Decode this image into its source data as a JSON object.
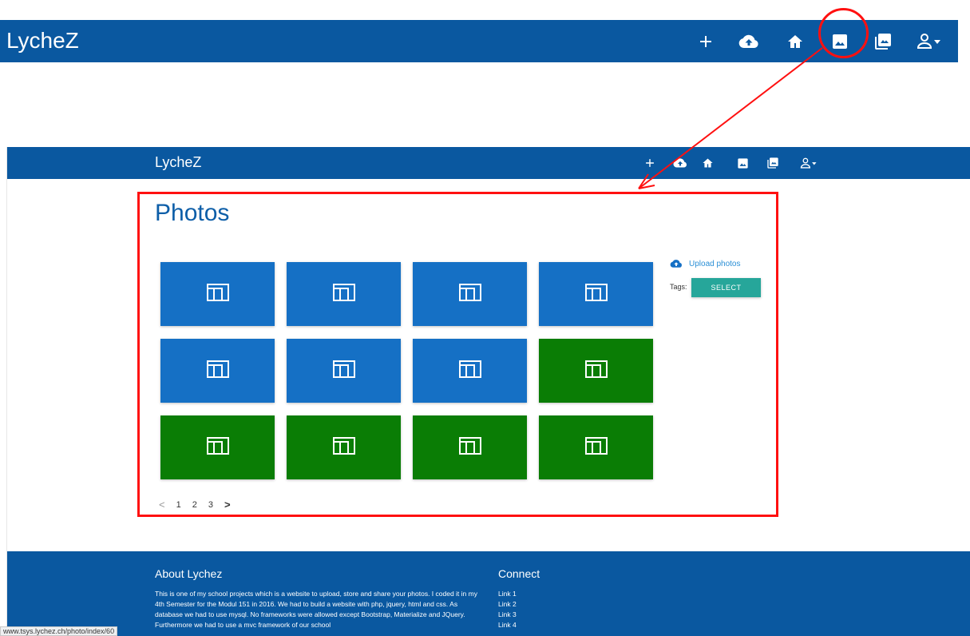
{
  "top_nav": {
    "brand": "LycheZ",
    "icons": [
      "plus-icon",
      "cloud-upload-icon",
      "home-icon",
      "image-icon",
      "photo-library-icon",
      "account-dropdown-icon"
    ]
  },
  "inner_nav": {
    "brand": "LycheZ"
  },
  "main": {
    "title": "Photos",
    "thumbnails": [
      {
        "color": "#1570c5"
      },
      {
        "color": "#1570c5"
      },
      {
        "color": "#1570c5"
      },
      {
        "color": "#1570c5"
      },
      {
        "color": "#1570c5"
      },
      {
        "color": "#1570c5"
      },
      {
        "color": "#1570c5"
      },
      {
        "color": "#0a7d05"
      },
      {
        "color": "#0a7d05"
      },
      {
        "color": "#0a7d05"
      },
      {
        "color": "#0a7d05"
      },
      {
        "color": "#0a7d05"
      }
    ],
    "sidebar": {
      "upload_label": "Upload photos",
      "tags_label": "Tags:",
      "select_label": "SELECT"
    },
    "pagination": {
      "prev": "<",
      "pages": [
        "1",
        "2",
        "3"
      ],
      "next": ">"
    }
  },
  "footer": {
    "about_title": "About Lychez",
    "about_text": "This is one of my school projects which is a website to upload, store and share your photos. I coded it in my 4th Semester for the Modul 151 in 2016. We had to build a website with php, jquery, html and css. As database we had to use mysql. No frameworks were allowed except Bootstrap, Materialize and JQuery. Furthermore we had to use a mvc framework of our school",
    "connect_title": "Connect",
    "links": [
      "Link 1",
      "Link 2",
      "Link 3",
      "Link 4"
    ]
  },
  "status_bar": {
    "url": "www.tsys.lychez.ch/photo/index/60"
  },
  "colors": {
    "nav": "#0a58a0",
    "title": "#0d5ea8",
    "select_button": "#26a69a",
    "annotation": "#ff1010"
  }
}
